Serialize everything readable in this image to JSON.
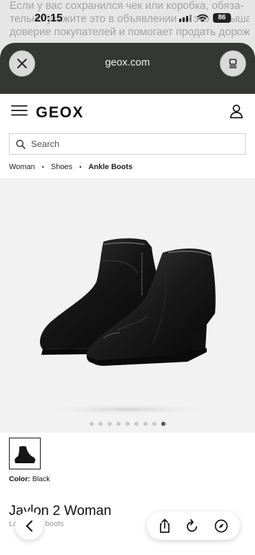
{
  "background_text": {
    "line1": "Если у вас сохранился чек или коробка, обяза-",
    "line2": "тельно укажите это в объявлении — это повышает",
    "line3": "доверие покупателей и помогает продать дороже."
  },
  "status_bar": {
    "time": "20:15",
    "battery": "86"
  },
  "browser": {
    "url": "geox.com"
  },
  "site": {
    "logo": "GEOX"
  },
  "search": {
    "placeholder": "Search"
  },
  "breadcrumb": {
    "items": [
      "Woman",
      "Shoes",
      "Ankle Boots"
    ]
  },
  "gallery": {
    "dot_count": 9,
    "active_index": 8
  },
  "product": {
    "color_label": "Color:",
    "color_value": "Black",
    "name": "Jaylon 2 Woman",
    "subtitle": "Low ankle boots"
  }
}
